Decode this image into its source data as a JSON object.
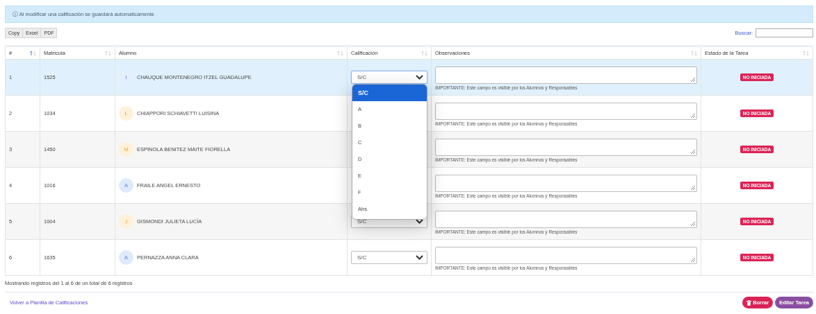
{
  "alert": {
    "icon": "ⓘ",
    "text": "Al modificar una calificación se guardará automaticamente"
  },
  "export_buttons": [
    "Copy",
    "Excel",
    "PDF"
  ],
  "search": {
    "label": "Buscar:"
  },
  "table": {
    "columns": [
      {
        "label": "#",
        "sorted": true
      },
      {
        "label": "Matrícula",
        "sorted": false
      },
      {
        "label": "Alumno",
        "sorted": false
      },
      {
        "label": "Calificación",
        "sorted": false
      },
      {
        "label": "Observaciones",
        "sorted": false
      },
      {
        "label": "Estado de la Tarea",
        "sorted": false
      }
    ],
    "rows": [
      {
        "number": "1",
        "id": "1525",
        "initial": "I",
        "color": "#e3effd",
        "name": "CHAUQUE MONTENEGRO ITZEL GUADALUPE",
        "grade": "S/C",
        "note": "IMPORTANTE: Este campo es visible por los Alumnos y Responsables",
        "status": "NO INICIADA",
        "selected": true
      },
      {
        "number": "2",
        "id": "1034",
        "initial": "L",
        "color": "#fff1d9",
        "name": "CHIAPPORI SCHIAVETTI LUISINA",
        "note": "IMPORTANTE: Este campo es visible por los Alumnos y Responsables",
        "status": "NO INICIADA",
        "selected": false
      },
      {
        "number": "3",
        "id": "1450",
        "initial": "M",
        "color": "#fff1d9",
        "name": "ESPINOLA BENITEZ MAITE FIORELLA",
        "note": "IMPORTANTE: Este campo es visible por los Alumnos y Responsables",
        "status": "NO INICIADA",
        "selected": false
      },
      {
        "number": "4",
        "id": "1016",
        "initial": "A",
        "color": "#ddebfc",
        "name": "FRAILE ANGEL ERNESTO",
        "note": "IMPORTANTE: Este campo es visible por los Alumnos y Responsables",
        "status": "NO INICIADA",
        "selected": false
      },
      {
        "number": "5",
        "id": "1004",
        "initial": "J",
        "color": "#fff1d9",
        "name": "GISMONDI JULIETA LUCÍA",
        "grade": "S/C",
        "note": "IMPORTANTE: Este campo es visible por los Alumnos y Responsables",
        "status": "NO INICIADA",
        "selected": false
      },
      {
        "number": "6",
        "id": "1635",
        "initial": "A",
        "color": "#ddebfc",
        "name": "PERNAZZA ANNA CLARA",
        "grade": "S/C",
        "note": "IMPORTANTE: Este campo es visible por los Alumnos y Responsables",
        "status": "NO INICIADA",
        "selected": false
      }
    ]
  },
  "grade_dropdown": {
    "options": [
      {
        "label": "S/C",
        "selected": true
      },
      {
        "label": "A",
        "selected": false
      },
      {
        "label": "B",
        "selected": false
      },
      {
        "label": "C",
        "selected": false
      },
      {
        "label": "D",
        "selected": false
      },
      {
        "label": "E",
        "selected": false
      },
      {
        "label": "F",
        "selected": false
      },
      {
        "label": "Abs.",
        "selected": false
      }
    ]
  },
  "info": "Mostrando registros del 1 al 6 de un total de 6 registros",
  "back_link": "Volver a Planilla de Calificaciones",
  "actions": [
    {
      "label": "Borrar",
      "kind": "delete"
    },
    {
      "label": "Editar Tarea",
      "kind": "edit"
    }
  ]
}
